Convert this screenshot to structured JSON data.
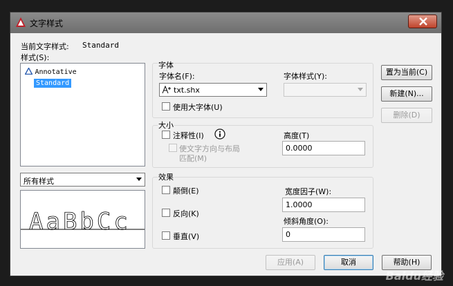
{
  "window": {
    "title": "文字样式"
  },
  "current_style": {
    "label": "当前文字样式:",
    "value": "Standard"
  },
  "styles": {
    "label": "样式(S):",
    "items": [
      {
        "label": "Annotative",
        "icon": "annotative-icon"
      },
      {
        "label": "Standard",
        "selected": true
      }
    ],
    "filter_value": "所有样式"
  },
  "preview": {
    "text": "AaBbCc"
  },
  "font": {
    "group_label": "字体",
    "name_label": "字体名(F):",
    "name_value": "txt.shx",
    "style_label": "字体样式(Y):",
    "style_value": "",
    "bigfont_label": "使用大字体(U)"
  },
  "size": {
    "group_label": "大小",
    "annotative_label": "注释性(I)",
    "match_orientation_line1": "使文字方向与布局",
    "match_orientation_line2": "匹配(M)",
    "height_label": "高度(T)",
    "height_value": "0.0000"
  },
  "effects": {
    "group_label": "效果",
    "upside_down_label": "颠倒(E)",
    "backwards_label": "反向(K)",
    "vertical_label": "垂直(V)",
    "width_factor_label": "宽度因子(W):",
    "width_factor_value": "1.0000",
    "oblique_label": "倾斜角度(O):",
    "oblique_value": "0"
  },
  "buttons": {
    "set_current": "置为当前(C)",
    "new": "新建(N)...",
    "delete": "删除(D)",
    "apply": "应用(A)",
    "cancel": "取消",
    "help": "帮助(H)"
  },
  "watermark": "Baidu经验",
  "colors": {
    "selection": "#3399ff",
    "info_icon": "#1a1a1a"
  }
}
